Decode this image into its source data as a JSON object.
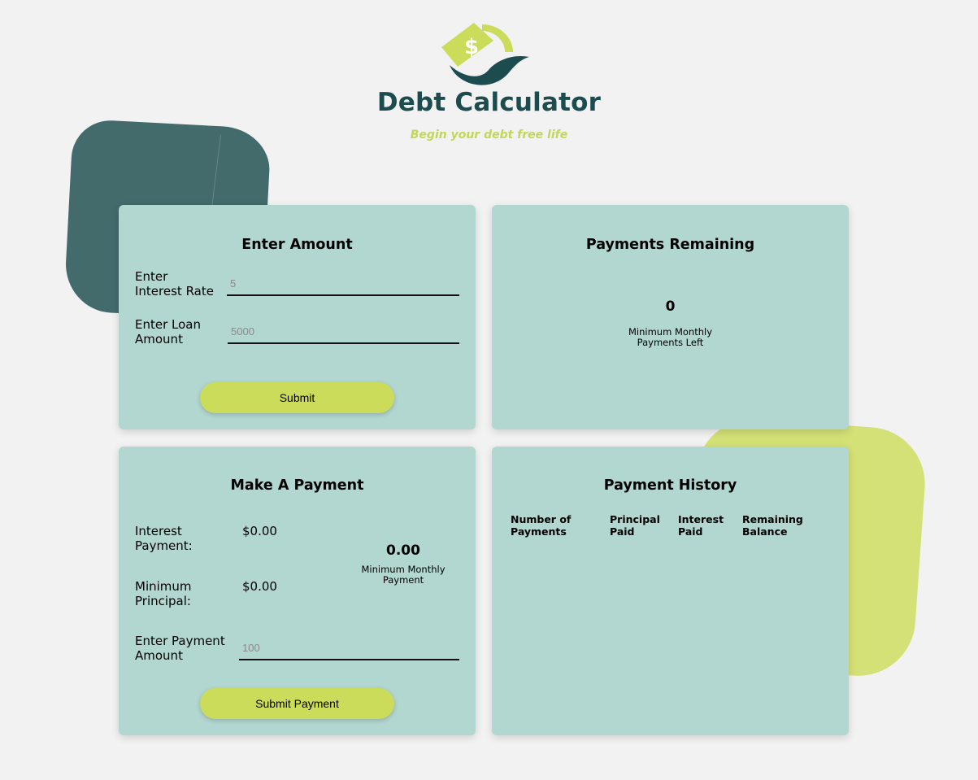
{
  "header": {
    "title": "Debt Calculator",
    "tagline": "Begin your debt free life",
    "logo_icon": "dollar-leaf-logo",
    "colors": {
      "dark": "#1d4c4f",
      "lime": "#cbdc5a"
    }
  },
  "enter_amount": {
    "title": "Enter Amount",
    "interest_label": "Enter Interest Rate",
    "interest_placeholder": "5",
    "loan_label": "Enter Loan Amount",
    "loan_placeholder": "5000",
    "submit_label": "Submit"
  },
  "payments_remaining": {
    "title": "Payments Remaining",
    "count": "0",
    "caption": "Minimum Monthly Payments Left"
  },
  "make_payment": {
    "title": "Make A Payment",
    "interest_payment_label": "Interest Payment:",
    "interest_payment_value": "$0.00",
    "min_principal_label": "Minimum Principal:",
    "min_principal_value": "$0.00",
    "min_monthly_value": "0.00",
    "min_monthly_caption": "Minimum Monthly Payment",
    "payment_amount_label": "Enter Payment Amount",
    "payment_amount_placeholder": "100",
    "submit_label": "Submit Payment"
  },
  "payment_history": {
    "title": "Payment History",
    "columns": [
      "Number of Payments",
      "Principal Paid",
      "Interest Paid",
      "Remaining Balance"
    ]
  }
}
